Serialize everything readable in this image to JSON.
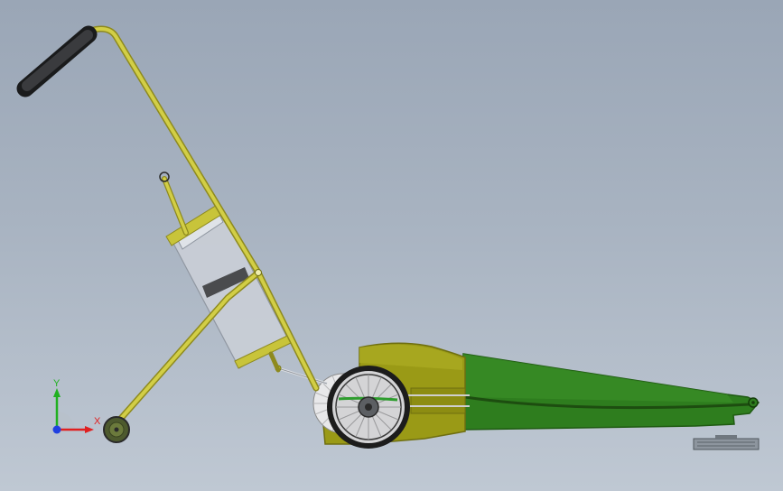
{
  "viewport": {
    "background_top": "#9aa6b6",
    "background_bottom": "#bfc8d3"
  },
  "model": {
    "colors": {
      "frame": "#c8c43a",
      "frame_dark": "#8e8a1e",
      "grip": "#2f3032",
      "body": "#9a9a16",
      "body_dark": "#6f6f10",
      "chute": "#2e7d1e",
      "chute_dark": "#1f5a12",
      "wheel_tire": "#1c1c1c",
      "hopper_glass": "#c9ced6"
    }
  },
  "triad": {
    "x_label": "X",
    "y_label": "Y",
    "x_color": "#e02020",
    "y_color": "#20b020",
    "z_color": "#2040e0"
  }
}
